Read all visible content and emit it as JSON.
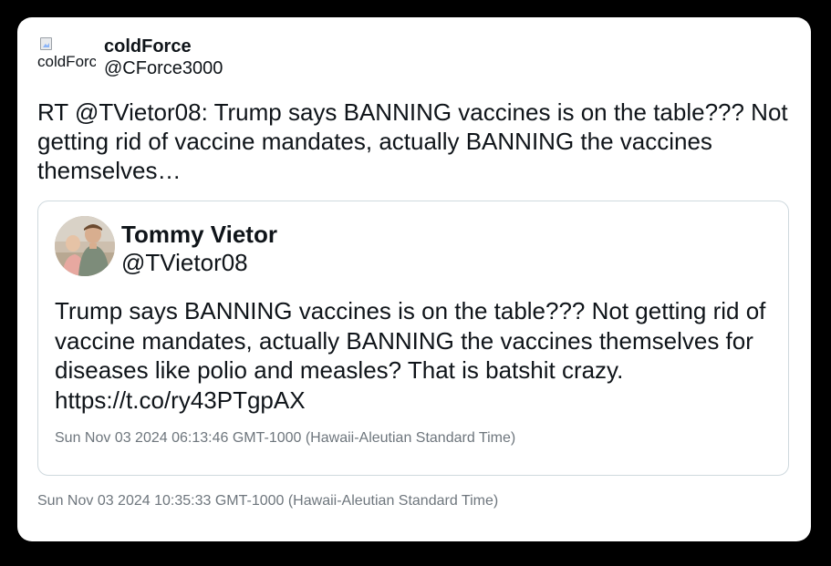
{
  "tweet": {
    "author_name": "coldForce",
    "author_handle": "@CForce3000",
    "avatar_alt": "coldForce",
    "text": "RT @TVietor08: Trump says BANNING vaccines is on the table??? Not getting rid of vaccine mandates, actually BANNING the vaccines themselves…",
    "timestamp": "Sun Nov 03 2024 10:35:33 GMT-1000 (Hawaii-Aleutian Standard Time)"
  },
  "quoted_tweet": {
    "author_name": "Tommy Vietor",
    "author_handle": "@TVietor08",
    "text": "Trump says BANNING vaccines is on the table??? Not getting rid of vaccine mandates, actually BANNING the vaccines themselves for diseases like polio and measles? That is batshit crazy. https://t.co/ry43PTgpAX",
    "timestamp": "Sun Nov 03 2024 06:13:46 GMT-1000 (Hawaii-Aleutian Standard Time)"
  },
  "colors": {
    "page_background": "#000000",
    "card_background": "#ffffff",
    "text_primary": "#0f1419",
    "text_secondary": "#6e767d",
    "border": "#cfd9de"
  },
  "icons": {
    "broken_image": "broken-image-icon"
  }
}
